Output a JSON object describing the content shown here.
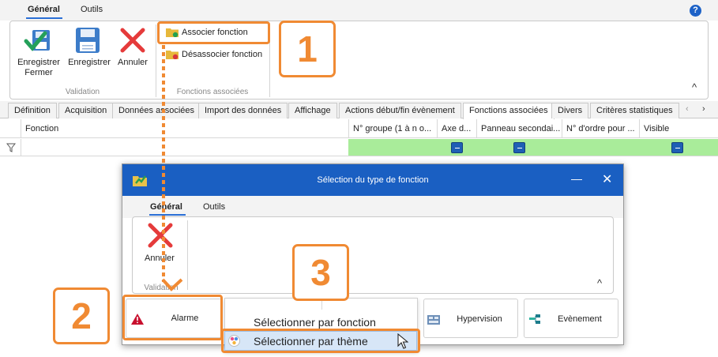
{
  "ribbon": {
    "tabs": [
      "Général",
      "Outils"
    ],
    "help": "?",
    "groups": {
      "validation": {
        "label": "Validation",
        "save_close_line1": "Enregistrer",
        "save_close_line2": "Fermer",
        "save": "Enregistrer",
        "cancel": "Annuler"
      },
      "functions": {
        "label": "Fonctions associées",
        "associate": "Associer fonction",
        "dissociate": "Désassocier fonction"
      }
    },
    "collapse": "^"
  },
  "page_tabs": [
    "Définition",
    "Acquisition",
    "Données associées",
    "Import des données",
    "Affichage",
    "Actions début/fin évènement",
    "Fonctions associées",
    "Divers",
    "Critères statistiques"
  ],
  "active_page_tab": "Fonctions associées",
  "grid": {
    "columns": [
      "Fonction",
      "N° groupe (1 à n o...",
      "Axe d...",
      "Panneau secondai...",
      "N° d'ordre pour ...",
      "Visible"
    ]
  },
  "dialog": {
    "title": "Sélection du type de fonction",
    "tabs": [
      "Général",
      "Outils"
    ],
    "cancel": "Annuler",
    "group_label": "Validation",
    "tiles": {
      "alarm": "Alarme",
      "hypervision": "Hypervision",
      "event": "Evènement"
    },
    "menu": {
      "by_function": "Sélectionner par fonction",
      "by_theme": "Sélectionner par thème"
    }
  },
  "callouts": [
    "1",
    "2",
    "3"
  ],
  "colors": {
    "accent": "#1a5fc2",
    "callout": "#f08a33",
    "filter_row": "#a9ec9a"
  }
}
